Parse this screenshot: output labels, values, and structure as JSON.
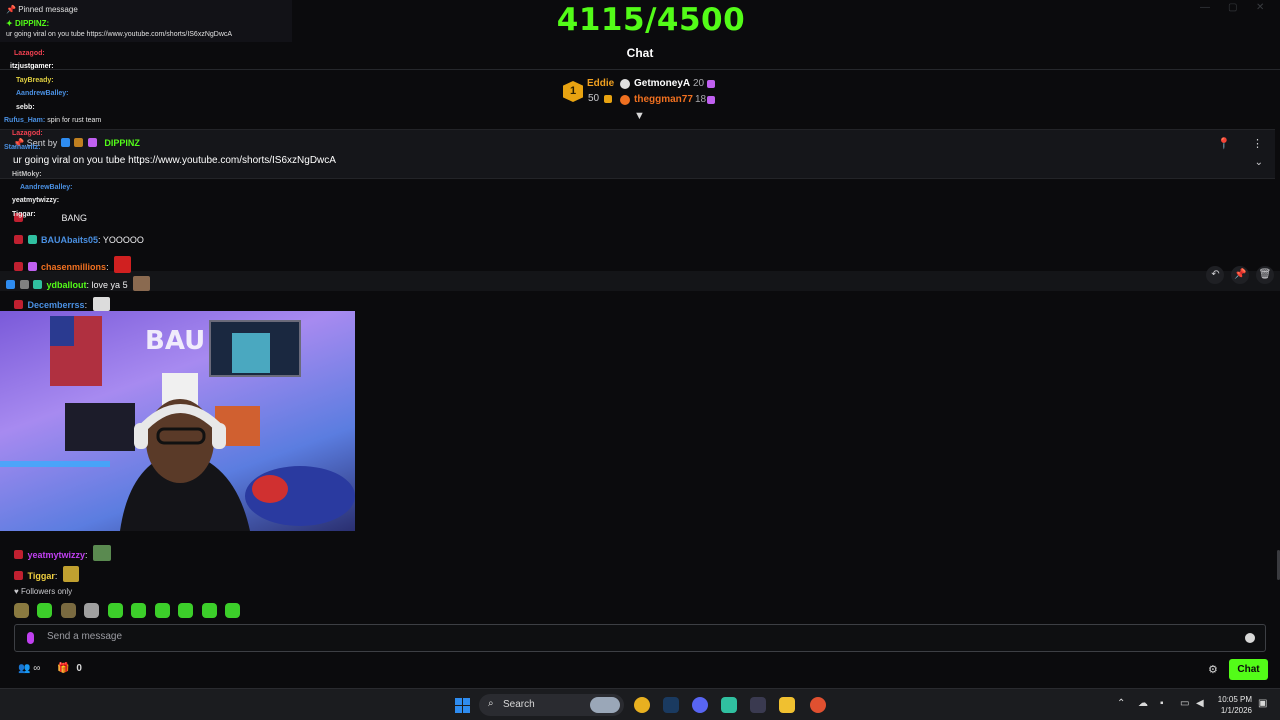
{
  "header": {
    "goal": "4115/4500",
    "title": "Chat"
  },
  "leaderboard": {
    "rank": "1",
    "first_name": "Eddie",
    "first_value": "50",
    "second_name": "GetmoneyA",
    "second_value": "20",
    "third_name": "theggman77",
    "third_value": "18"
  },
  "pinned": {
    "sent_by_label": "Sent by",
    "sender": "DIPPINZ",
    "message": "ur going viral on you tube https://www.youtube.com/shorts/IS6xzNgDwcA"
  },
  "overlay": {
    "pinned_label": "Pinned message",
    "sender": "DIPPINZ:",
    "message": "ur going viral on you tube https://www.youtube.com/shorts/IS6xzNgDwcA",
    "mini_messages": [
      {
        "user": "Lazagod:",
        "text": "",
        "color": "#f04050"
      },
      {
        "user": "itzjustgamer:",
        "text": "",
        "color": "#ffffff"
      },
      {
        "user": "TayBready:",
        "text": "",
        "color": "#e0d040"
      },
      {
        "user": "AandrewBalley:",
        "text": "",
        "color": "#4a90e2"
      },
      {
        "user": "sebb:",
        "text": "",
        "color": "#f0f0f0"
      },
      {
        "user": "Rufus_Ham:",
        "text": "spin for rust team",
        "color": "#4a90e2"
      },
      {
        "user": "Lazagod:",
        "text": "",
        "color": "#f04050"
      },
      {
        "user": "Stainawitz:",
        "text": "",
        "color": "#4a90e2"
      },
      {
        "user": "AandrewBalley:",
        "text": "",
        "color": "#4a90e2"
      },
      {
        "user": "HitMoky:",
        "text": "",
        "color": "#c0c0c0"
      },
      {
        "user": "yeatmytwizzy:",
        "text": "",
        "color": "#f0f0f0"
      },
      {
        "user": "Tiggar:",
        "text": "",
        "color": "#f0f0f0"
      }
    ]
  },
  "messages": [
    {
      "user": "",
      "text": "BANG",
      "color": "#ffffff"
    },
    {
      "user": "BAUAbaits05",
      "text": ": YOOOOO",
      "color": "#4a90e2"
    },
    {
      "user": "chasenmillions",
      "text": ":",
      "color": "#f07020"
    },
    {
      "user": "ydballout",
      "text": ": love ya 5",
      "color": "#53fc18"
    },
    {
      "user": "Decemberrss",
      "text": ":",
      "color": "#4a90e2"
    },
    {
      "user": "yeatmytwizzy",
      "text": ":",
      "color": "#c040f0"
    },
    {
      "user": "Tiggar",
      "text": ":",
      "color": "#f0d040"
    }
  ],
  "status": {
    "followers_only": "Followers only"
  },
  "input": {
    "placeholder": "Send a message"
  },
  "footer": {
    "count": "0",
    "chat_button": "Chat"
  },
  "taskbar": {
    "search_label": "Search",
    "time": "10:05 PM",
    "date": "1/1/2026"
  },
  "colors": {
    "accent": "#53fc18",
    "background": "#0b0b0d"
  }
}
